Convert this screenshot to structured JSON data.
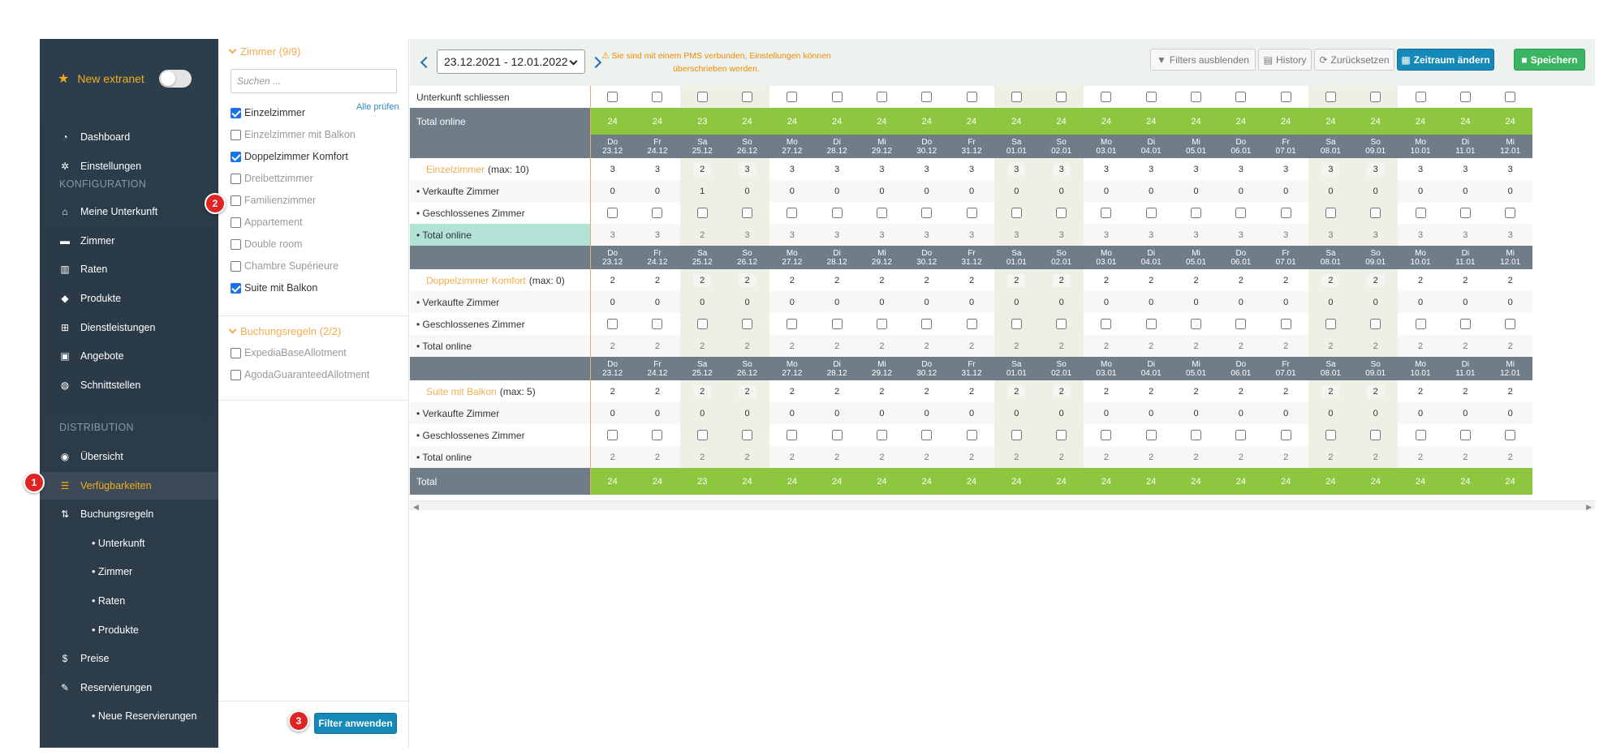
{
  "sidebar": {
    "new_extranet": "New extranet",
    "dashboard": "Dashboard",
    "einstellungen": "Einstellungen",
    "section_konfiguration": "KONFIGURATION",
    "meine_unterkunft": "Meine Unterkunft",
    "zimmer": "Zimmer",
    "raten": "Raten",
    "produkte": "Produkte",
    "dienstleistungen": "Dienstleistungen",
    "angebote": "Angebote",
    "schnittstellen": "Schnittstellen",
    "section_distribution": "DISTRIBUTION",
    "uebersicht": "Übersicht",
    "verfuegbarkeiten": "Verfügbarkeiten",
    "buchungsregeln": "Buchungsregeln",
    "sub_unterkunft": "• Unterkunft",
    "sub_zimmer": "• Zimmer",
    "sub_raten": "• Raten",
    "sub_produkte": "• Produkte",
    "preise": "Preise",
    "reservierungen": "Reservierungen",
    "sub_neue_reservierungen": "• Neue Reservierungen"
  },
  "badges": {
    "b1": "1",
    "b2": "2",
    "b3": "3"
  },
  "filter": {
    "zimmer_title": "Zimmer (9/9)",
    "search_placeholder": "Suchen ...",
    "alle_pruefen": "Alle prüfen",
    "rooms": [
      {
        "label": "Einzelzimmer",
        "checked": true
      },
      {
        "label": "Einzelzimmer mit Balkon",
        "checked": false
      },
      {
        "label": "Doppelzimmer Komfort",
        "checked": true
      },
      {
        "label": "Dreibettzimmer",
        "checked": false
      },
      {
        "label": "Familienzimmer",
        "checked": false
      },
      {
        "label": "Appartement",
        "checked": false
      },
      {
        "label": "Double room",
        "checked": false
      },
      {
        "label": "Chambre Supérieure",
        "checked": false
      },
      {
        "label": "Suite mit Balkon",
        "checked": true
      }
    ],
    "buchungsregeln_title": "Buchungsregeln (2/2)",
    "rules": [
      {
        "label": "ExpediaBaseAllotment",
        "checked": false
      },
      {
        "label": "AgodaGuaranteedAllotment",
        "checked": false
      }
    ],
    "apply_label": "Filter anwenden"
  },
  "toolbar": {
    "date_range": "23.12.2021 - 12.01.2022",
    "warning_line1": "⚠ Sie sind mit einem PMS verbunden, Einstellungen können",
    "warning_line2": "überschrieben werden.",
    "filters_label": "Filters ausblenden",
    "history_label": "History",
    "reset_label": "Zurücksetzen",
    "zeitraum_label": "Zeitraum ändern",
    "save_label": "Speichern"
  },
  "grid": {
    "days": [
      {
        "wd": "Do",
        "d": "23.12",
        "we": false
      },
      {
        "wd": "Fr",
        "d": "24.12",
        "we": false
      },
      {
        "wd": "Sa",
        "d": "25.12",
        "we": true
      },
      {
        "wd": "So",
        "d": "26.12",
        "we": true
      },
      {
        "wd": "Mo",
        "d": "27.12",
        "we": false
      },
      {
        "wd": "Di",
        "d": "28.12",
        "we": false
      },
      {
        "wd": "Mi",
        "d": "29.12",
        "we": false
      },
      {
        "wd": "Do",
        "d": "30.12",
        "we": false
      },
      {
        "wd": "Fr",
        "d": "31.12",
        "we": false
      },
      {
        "wd": "Sa",
        "d": "01.01",
        "we": true
      },
      {
        "wd": "So",
        "d": "02.01",
        "we": true
      },
      {
        "wd": "Mo",
        "d": "03.01",
        "we": false
      },
      {
        "wd": "Di",
        "d": "04.01",
        "we": false
      },
      {
        "wd": "Mi",
        "d": "05.01",
        "we": false
      },
      {
        "wd": "Do",
        "d": "06.01",
        "we": false
      },
      {
        "wd": "Fr",
        "d": "07.01",
        "we": false
      },
      {
        "wd": "Sa",
        "d": "08.01",
        "we": true
      },
      {
        "wd": "So",
        "d": "09.01",
        "we": true
      },
      {
        "wd": "Mo",
        "d": "10.01",
        "we": false
      },
      {
        "wd": "Di",
        "d": "11.01",
        "we": false
      },
      {
        "wd": "Mi",
        "d": "12.01",
        "we": false
      }
    ],
    "unterkunft_schliessen": "Unterkunft schliessen",
    "total_online_label": "Total online",
    "total_online_values": [
      "24",
      "24",
      "23",
      "24",
      "24",
      "24",
      "24",
      "24",
      "24",
      "24",
      "24",
      "24",
      "24",
      "24",
      "24",
      "24",
      "24",
      "24",
      "24",
      "24",
      "24"
    ],
    "sub_verkaufte": "• Verkaufte Zimmer",
    "sub_geschlossen": "• Geschlossenes Zimmer",
    "sub_total_online": "• Total online",
    "rooms": [
      {
        "name": "Einzelzimmer",
        "max": "(max: 10)",
        "avail": [
          "3",
          "3",
          "2",
          "3",
          "3",
          "3",
          "3",
          "3",
          "3",
          "3",
          "3",
          "3",
          "3",
          "3",
          "3",
          "3",
          "3",
          "3",
          "3",
          "3",
          "3"
        ],
        "sold": [
          "0",
          "0",
          "1",
          "0",
          "0",
          "0",
          "0",
          "0",
          "0",
          "0",
          "0",
          "0",
          "0",
          "0",
          "0",
          "0",
          "0",
          "0",
          "0",
          "0",
          "0"
        ],
        "total": [
          "3",
          "3",
          "2",
          "3",
          "3",
          "3",
          "3",
          "3",
          "3",
          "3",
          "3",
          "3",
          "3",
          "3",
          "3",
          "3",
          "3",
          "3",
          "3",
          "3",
          "3"
        ]
      },
      {
        "name": "Doppelzimmer Komfort",
        "max": "(max: 0)",
        "avail": [
          "2",
          "2",
          "2",
          "2",
          "2",
          "2",
          "2",
          "2",
          "2",
          "2",
          "2",
          "2",
          "2",
          "2",
          "2",
          "2",
          "2",
          "2",
          "2",
          "2",
          "2"
        ],
        "sold": [
          "0",
          "0",
          "0",
          "0",
          "0",
          "0",
          "0",
          "0",
          "0",
          "0",
          "0",
          "0",
          "0",
          "0",
          "0",
          "0",
          "0",
          "0",
          "0",
          "0",
          "0"
        ],
        "total": [
          "2",
          "2",
          "2",
          "2",
          "2",
          "2",
          "2",
          "2",
          "2",
          "2",
          "2",
          "2",
          "2",
          "2",
          "2",
          "2",
          "2",
          "2",
          "2",
          "2",
          "2"
        ]
      },
      {
        "name": "Suite mit Balkon",
        "max": "(max: 5)",
        "avail": [
          "2",
          "2",
          "2",
          "2",
          "2",
          "2",
          "2",
          "2",
          "2",
          "2",
          "2",
          "2",
          "2",
          "2",
          "2",
          "2",
          "2",
          "2",
          "2",
          "2",
          "2"
        ],
        "sold": [
          "0",
          "0",
          "0",
          "0",
          "0",
          "0",
          "0",
          "0",
          "0",
          "0",
          "0",
          "0",
          "0",
          "0",
          "0",
          "0",
          "0",
          "0",
          "0",
          "0",
          "0"
        ],
        "total": [
          "2",
          "2",
          "2",
          "2",
          "2",
          "2",
          "2",
          "2",
          "2",
          "2",
          "2",
          "2",
          "2",
          "2",
          "2",
          "2",
          "2",
          "2",
          "2",
          "2",
          "2"
        ]
      }
    ],
    "total_label": "Total",
    "total_values": [
      "24",
      "24",
      "23",
      "24",
      "24",
      "24",
      "24",
      "24",
      "24",
      "24",
      "24",
      "24",
      "24",
      "24",
      "24",
      "24",
      "24",
      "24",
      "24",
      "24",
      "24"
    ]
  },
  "colors": {
    "accent_orange": "#f0ad4e",
    "primary_blue": "#1589b8",
    "save_green": "#3cb563",
    "total_green": "#8dc63f",
    "header_slate": "#6f7d88"
  },
  "icons": {
    "star": "star-icon",
    "dashboard": "gauge-icon",
    "settings": "gear-icon",
    "home": "home-icon",
    "bed": "bed-icon",
    "rates": "barcode-icon",
    "tags": "tags-icon",
    "cart": "cart-icon",
    "gift": "gift-icon",
    "globe": "globe-icon",
    "eye": "eye-icon",
    "table": "table-icon",
    "sort": "sort-icon",
    "dollar": "dollar-icon",
    "pin": "pin-icon"
  }
}
